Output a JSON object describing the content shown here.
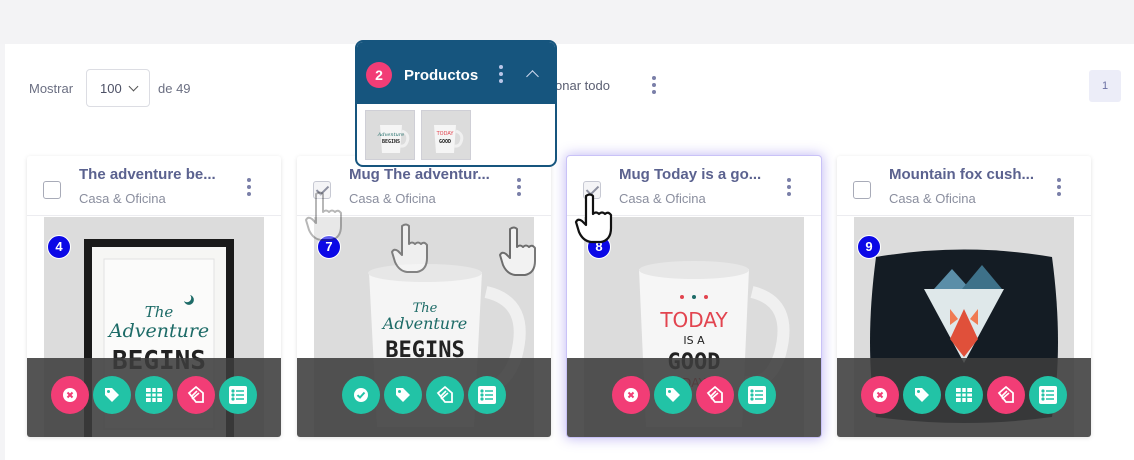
{
  "toolbar": {
    "show_label": "Mostrar",
    "per_page_value": "100",
    "of_label": "de 49",
    "select_all_label": "onar todo",
    "current_page": "1"
  },
  "selection_popover": {
    "count": "2",
    "title": "Productos"
  },
  "products": [
    {
      "title": "The adventure be...",
      "category": "Casa & Oficina",
      "number": "4",
      "checked": false
    },
    {
      "title": "Mug The adventur...",
      "category": "Casa & Oficina",
      "number": "7",
      "checked": true
    },
    {
      "title": "Mug Today is a go...",
      "category": "Casa & Oficina",
      "number": "8",
      "checked": true
    },
    {
      "title": "Mountain fox cush...",
      "category": "Casa & Oficina",
      "number": "9",
      "checked": false
    }
  ],
  "colors": {
    "accent_pink": "#f23d76",
    "accent_teal": "#22c3a6",
    "popover_header": "#16557e",
    "badge_blue": "#0b08e6",
    "title_text": "#5b628f"
  },
  "icons": [
    "close-icon",
    "check-icon",
    "tag-icon",
    "grid-icon",
    "tags-icon",
    "checklist-icon",
    "hand-pointer-icon",
    "kebab-icon",
    "chevron-up-icon",
    "chevron-down-icon"
  ]
}
